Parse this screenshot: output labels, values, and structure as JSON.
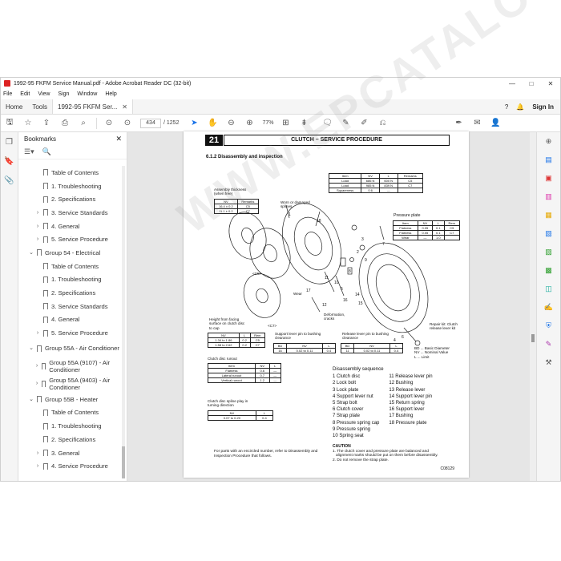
{
  "window": {
    "title": "1992-95 FKFM Service Manual.pdf - Adobe Acrobat Reader DC (32-bit)",
    "controls": [
      "—",
      "□",
      "✕"
    ]
  },
  "menu": [
    "File",
    "Edit",
    "View",
    "Sign",
    "Window",
    "Help"
  ],
  "tabs": {
    "home": "Home",
    "tools": "Tools",
    "doc": "1992-95 FKFM Ser...",
    "signin": "Sign In"
  },
  "toolbar": {
    "page_current": "434",
    "page_total": "/ 1252",
    "zoom": "77%"
  },
  "bookmarks": {
    "title": "Bookmarks",
    "items": [
      {
        "label": "Table of Contents",
        "level": 2,
        "expand": false
      },
      {
        "label": "1. Troubleshooting",
        "level": 2,
        "expand": false
      },
      {
        "label": "2. Specifications",
        "level": 2,
        "expand": false
      },
      {
        "label": "3. Service Standards",
        "level": 2,
        "expand": true
      },
      {
        "label": "4. General",
        "level": 2,
        "expand": true
      },
      {
        "label": "5. Service Procedure",
        "level": 2,
        "expand": true
      },
      {
        "label": "Group 54 - Electrical",
        "level": 1,
        "expand": "open"
      },
      {
        "label": "Table of Contents",
        "level": 2,
        "expand": false
      },
      {
        "label": "1. Troubleshooting",
        "level": 2,
        "expand": false
      },
      {
        "label": "2. Specifications",
        "level": 2,
        "expand": false
      },
      {
        "label": "3. Service Standards",
        "level": 2,
        "expand": false
      },
      {
        "label": "4. General",
        "level": 2,
        "expand": false
      },
      {
        "label": "5. Service Procedure",
        "level": 2,
        "expand": true
      },
      {
        "label": "Group 55A - Air Conditioner",
        "level": 1,
        "expand": "open"
      },
      {
        "label": "Group 55A (9107) - Air Conditioner",
        "level": 2,
        "expand": true
      },
      {
        "label": "Group 55A (9403) - Air Conditioner",
        "level": 2,
        "expand": true
      },
      {
        "label": "Group 55B - Heater",
        "level": 1,
        "expand": "open"
      },
      {
        "label": "Table of Contents",
        "level": 2,
        "expand": false
      },
      {
        "label": "1. Troubleshooting",
        "level": 2,
        "expand": false
      },
      {
        "label": "2. Specifications",
        "level": 2,
        "expand": false
      },
      {
        "label": "3. General",
        "level": 2,
        "expand": true
      },
      {
        "label": "4. Service Procedure",
        "level": 2,
        "expand": true
      }
    ]
  },
  "page": {
    "number": "21",
    "header": "CLUTCH – SERVICE PROCEDURE",
    "section": "6.1.2 Disassembly and inspection",
    "labels": {
      "assembly_thickness": "Assembly thickness (when free)",
      "worn_splines": "Worn or damaged splines",
      "pressure_plate": "Pressure plate",
      "wear": "Wear",
      "deformation": "Deformation, cracks",
      "height": "Height from facing surface on clutch disc to cap",
      "c5": "<C5>",
      "c7": "<C7>",
      "support_play": "Support lever pin to bushing clearance",
      "release_play": "Release lever pin to bushing clearance",
      "runout": "Clutch disc runout",
      "spline_play": "Clutch disc spline play in turning direction",
      "repair_kit": "Repair kit: Clutch release lever kit",
      "legend": "BD ... Basic Diameter\nNV ... Nominal Value\nL ... Limit",
      "encircled_note": "For parts with an encircled number, refer to Disassembly and Inspection Procedure that follows.",
      "part_code": "C08129"
    },
    "sequence_title": "Disassembly sequence",
    "sequence_left": [
      "1 Clutch disc",
      "2 Lock bolt",
      "3 Lock plate",
      "4 Support lever nut",
      "5 Strap bolt",
      "6 Clutch cover",
      "7 Strap plate",
      "8 Pressure spring cap",
      "9 Pressure spring",
      "10 Spring seat"
    ],
    "sequence_right": [
      "11 Release lever pin",
      "12 Bushing",
      "13 Release lever",
      "14 Support lever pin",
      "15 Return spring",
      "16 Support lever",
      "17 Bushing",
      "18 Pressure plate"
    ],
    "caution": {
      "title": "CAUTION",
      "lines": [
        "1. The clutch cover and pressure plate are balanced and",
        "alignment marks should be put on them before disassembly.",
        "2. Do not remove the strap plate."
      ]
    },
    "watermark": "WWW.EPCATALOG.COM"
  }
}
